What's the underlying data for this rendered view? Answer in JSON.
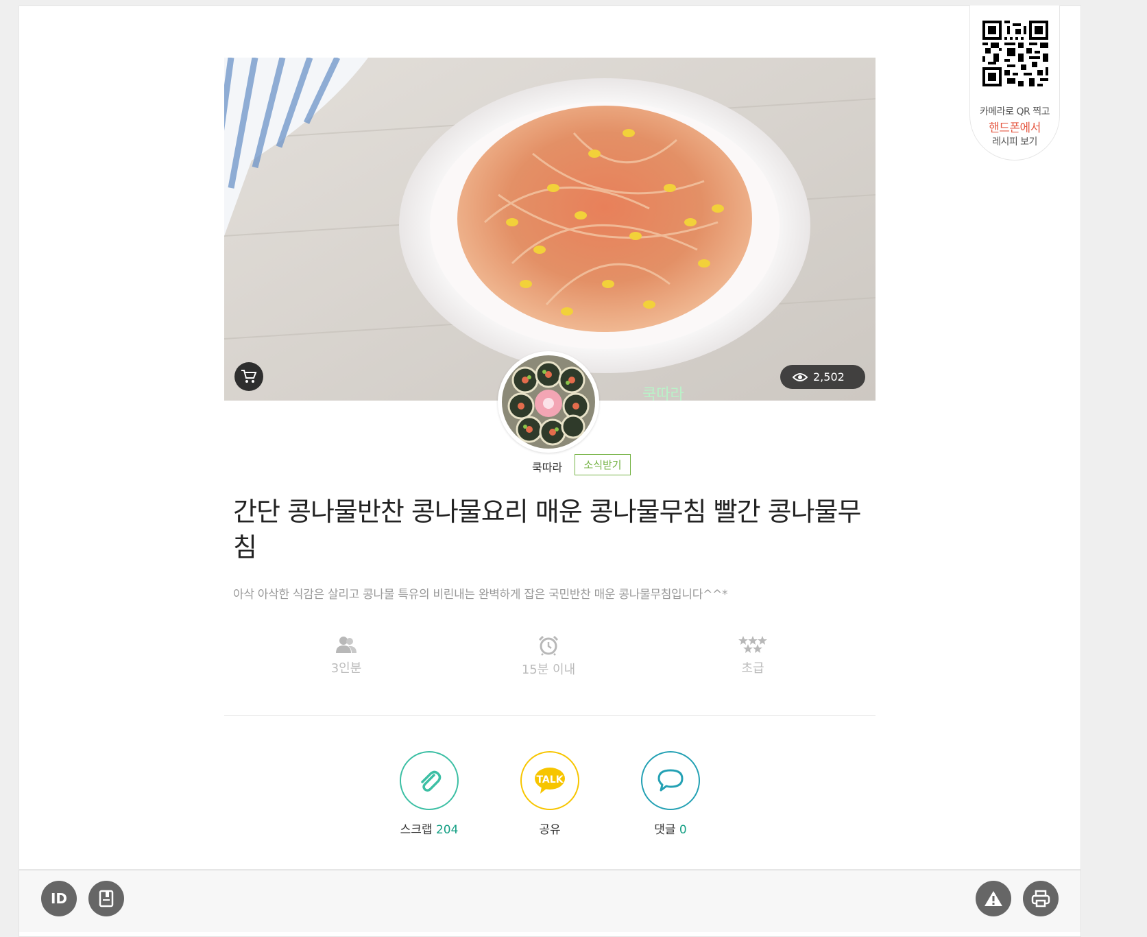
{
  "qr": {
    "line1": "카메라로 QR 찍고",
    "line2": "핸드폰에서",
    "line3": "레시피 보기"
  },
  "hero": {
    "views": "2,502",
    "watermark": "쿡따라"
  },
  "author": {
    "name": "쿡따라",
    "follow_label": "소식받기"
  },
  "recipe": {
    "title": "간단 콩나물반찬 콩나물요리 매운 콩나물무침 빨간 콩나물무침",
    "description": "아삭 아삭한 식감은 살리고 콩나물 특유의 비린내는 완벽하게 잡은 국민반찬 매운 콩나물무침입니다^^*",
    "servings": "3인분",
    "time": "15분 이내",
    "difficulty": "초급"
  },
  "actions": {
    "scrap_label": "스크랩",
    "scrap_count": "204",
    "share_label": "공유",
    "comment_label": "댓글",
    "comment_count": "0",
    "talk_text": "TALK"
  },
  "footer": {
    "id_label": "ID"
  },
  "colors": {
    "accent_green": "#74b243",
    "teal": "#16a085",
    "kakao_yellow": "#f7c500",
    "qr_highlight": "#e55a44"
  }
}
